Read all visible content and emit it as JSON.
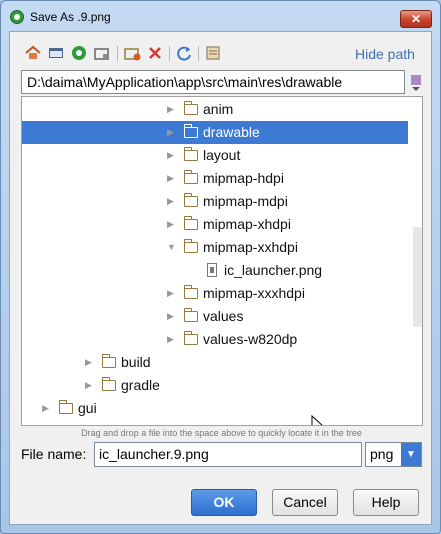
{
  "window": {
    "title": "Save As .9.png",
    "close_glyph": "✕"
  },
  "toolbar": {
    "icons": [
      "home-icon",
      "desktop-icon",
      "project-icon",
      "module-folder-icon",
      "new-folder-icon",
      "delete-icon",
      "refresh-icon",
      "show-hidden-icon"
    ],
    "hide_path_label": "Hide path"
  },
  "path": {
    "value": "D:\\daima\\MyApplication\\app\\src\\main\\res\\drawable"
  },
  "tree": {
    "items": [
      {
        "label": "anim",
        "kind": "folder",
        "expanded": false,
        "level": 3
      },
      {
        "label": "drawable",
        "kind": "folder",
        "expanded": false,
        "level": 3,
        "selected": true
      },
      {
        "label": "layout",
        "kind": "folder",
        "expanded": false,
        "level": 3
      },
      {
        "label": "mipmap-hdpi",
        "kind": "folder",
        "expanded": false,
        "level": 3
      },
      {
        "label": "mipmap-mdpi",
        "kind": "folder",
        "expanded": false,
        "level": 3
      },
      {
        "label": "mipmap-xhdpi",
        "kind": "folder",
        "expanded": false,
        "level": 3
      },
      {
        "label": "mipmap-xxhdpi",
        "kind": "folder",
        "expanded": true,
        "level": 3
      },
      {
        "label": "ic_launcher.png",
        "kind": "file",
        "level": 4
      },
      {
        "label": "mipmap-xxxhdpi",
        "kind": "folder",
        "expanded": false,
        "level": 3
      },
      {
        "label": "values",
        "kind": "folder",
        "expanded": false,
        "level": 3
      },
      {
        "label": "values-w820dp",
        "kind": "folder",
        "expanded": false,
        "level": 3
      },
      {
        "label": "build",
        "kind": "folder",
        "expanded": false,
        "level": 1
      },
      {
        "label": "gradle",
        "kind": "folder",
        "expanded": false,
        "level": 1
      },
      {
        "label": "gui",
        "kind": "folder",
        "expanded": false,
        "level": 0
      }
    ]
  },
  "hint": "Drag and drop a file into the space above to quickly locate it in the tree",
  "filename": {
    "label": "File name:",
    "value": "ic_launcher.9.png"
  },
  "filetype": {
    "value": "png"
  },
  "buttons": {
    "ok": "OK",
    "cancel": "Cancel",
    "help": "Help"
  }
}
